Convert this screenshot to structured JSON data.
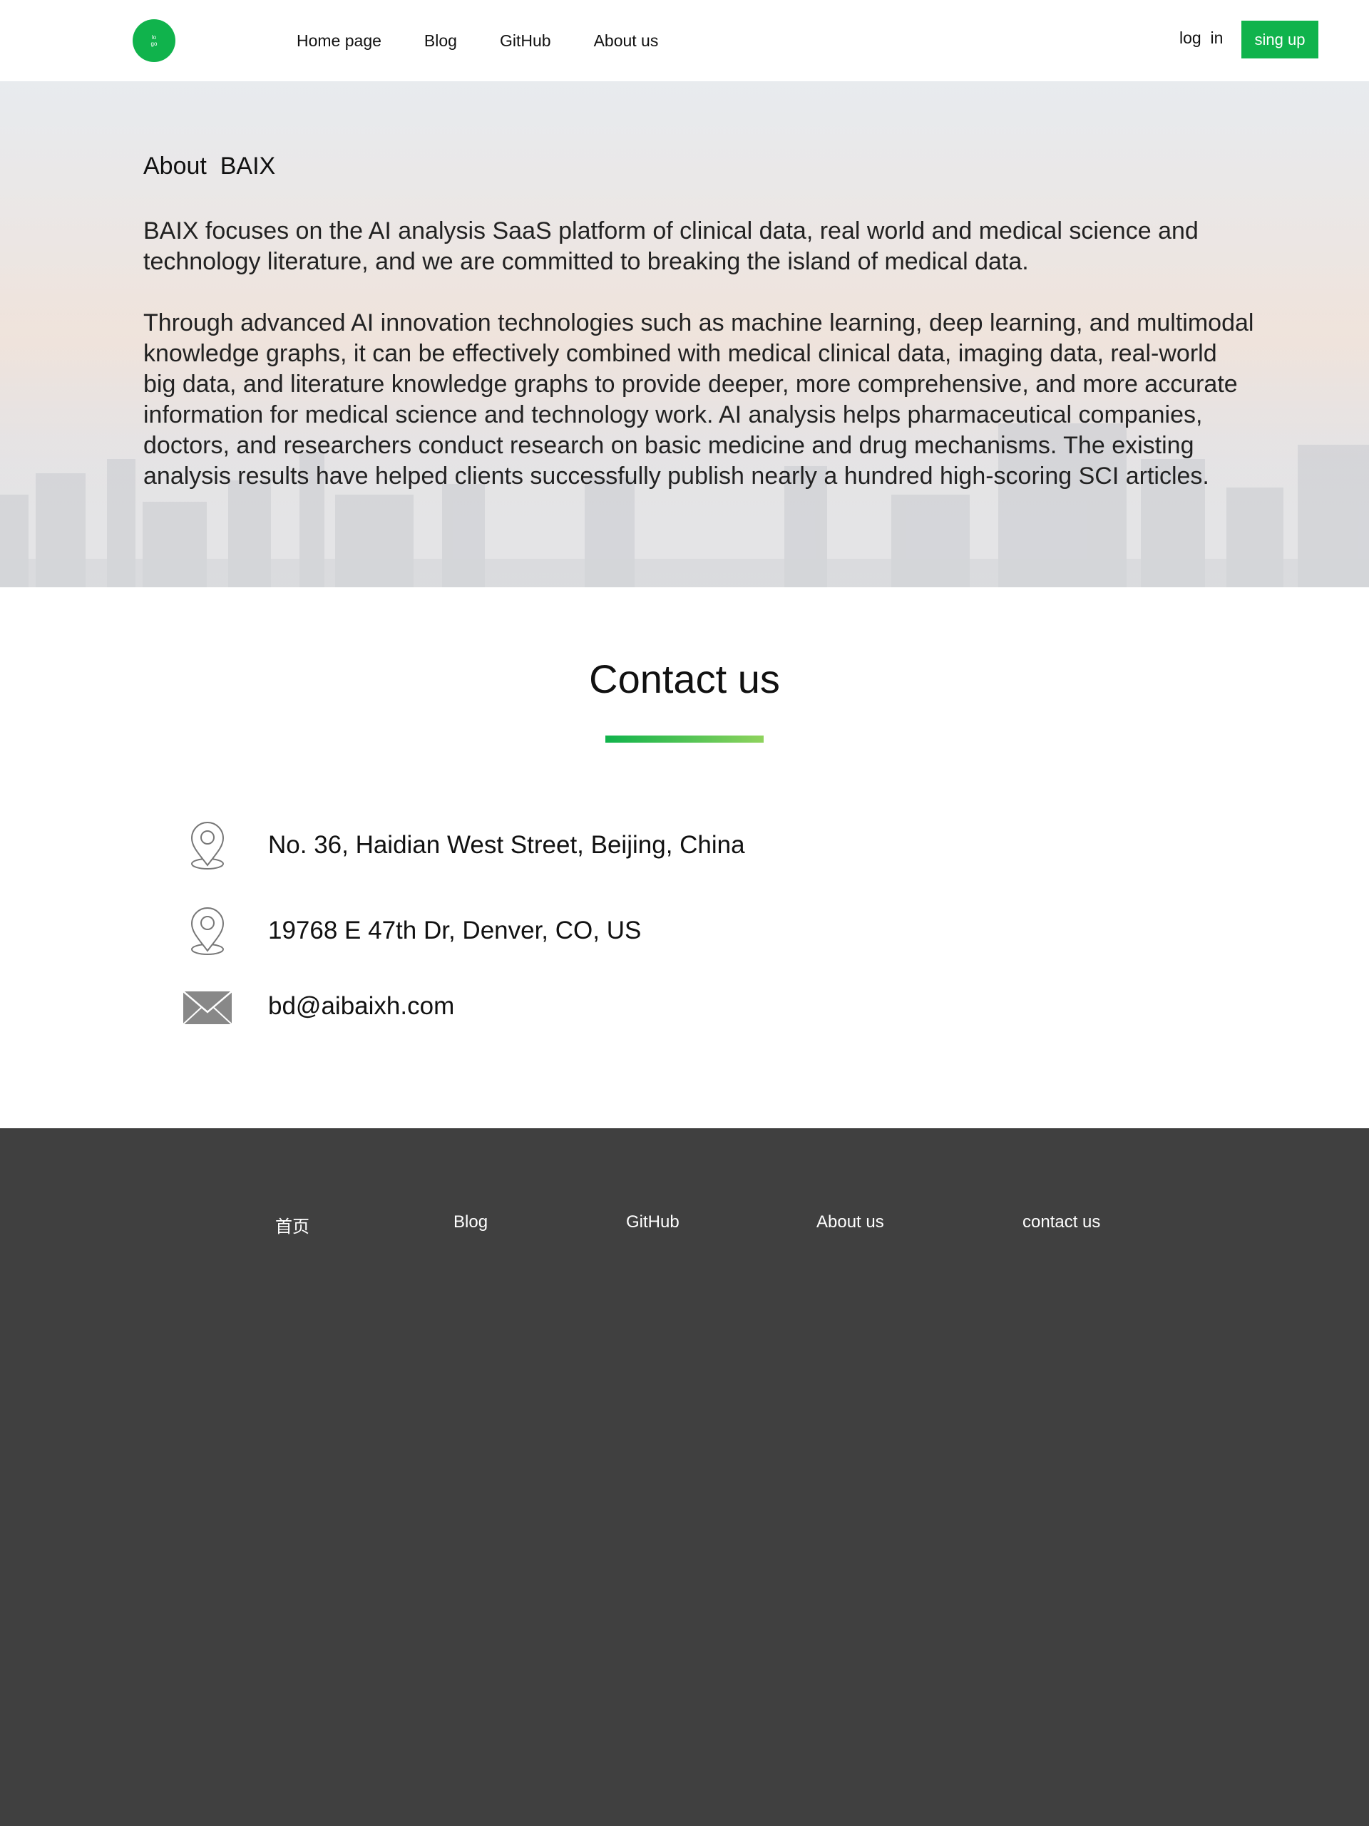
{
  "header": {
    "logo_line1": "lo",
    "logo_line2": "go",
    "nav": [
      "Home page",
      "Blog",
      "GitHub",
      "About us"
    ],
    "login_label": "log  in",
    "signup_label": "sing up"
  },
  "about": {
    "title": "About  BAIX",
    "paragraph1": "BAIX focuses on the AI analysis SaaS platform of clinical data, real world and medical science and technology literature, and we are committed to breaking the island of medical data.",
    "paragraph2": "Through advanced AI innovation technologies such as machine learning, deep learning, and multimodal knowledge graphs, it can be effectively combined with medical clinical data, imaging data, real-world big data, and literature knowledge graphs to provide deeper, more comprehensive, and more accurate information for medical science and technology work. AI analysis helps pharmaceutical companies, doctors, and researchers conduct research on basic medicine and drug mechanisms. The existing analysis results have helped clients successfully publish nearly a hundred high-scoring SCI articles."
  },
  "contact": {
    "title": "Contact us",
    "items": [
      {
        "icon": "location-pin-icon",
        "text": "No. 36, Haidian West Street, Beijing, China"
      },
      {
        "icon": "location-pin-icon",
        "text": "19768 E 47th Dr, Denver, CO, US"
      },
      {
        "icon": "envelope-icon",
        "text": "bd@aibaixh.com"
      }
    ]
  },
  "footer": {
    "links": [
      "首页",
      "Blog",
      "GitHub",
      "About us",
      "contact us"
    ]
  },
  "colors": {
    "accent": "#10b34c",
    "footer_bg": "#404040"
  }
}
